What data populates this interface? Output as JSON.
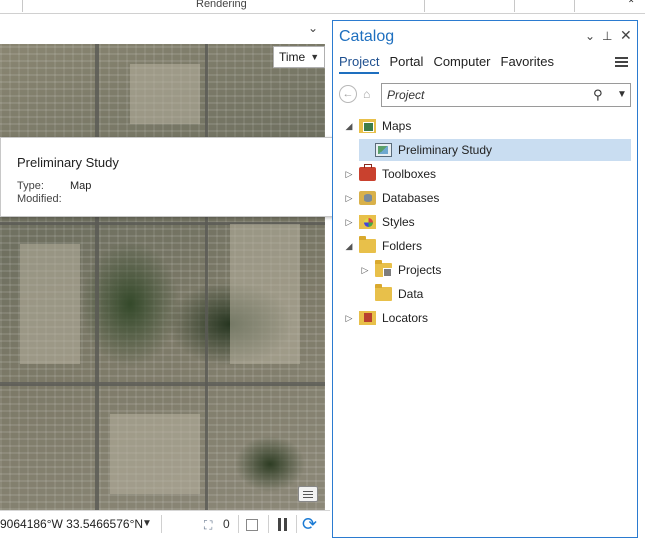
{
  "ribbon": {
    "group_label": "Rendering"
  },
  "map_view": {
    "time_button": {
      "label": "Time",
      "icon": "chevron-down-icon"
    },
    "popup": {
      "title": "Preliminary Study",
      "type_label": "Type:",
      "type_value": "Map",
      "modified_label": "Modified:",
      "modified_value": ""
    }
  },
  "statusbar": {
    "coordinates": "9064186°W 33.5466576°N",
    "selected_count": "0"
  },
  "catalog": {
    "title": "Catalog",
    "tabs": [
      {
        "label": "Project",
        "active": true
      },
      {
        "label": "Portal",
        "active": false
      },
      {
        "label": "Computer",
        "active": false
      },
      {
        "label": "Favorites",
        "active": false
      }
    ],
    "search": {
      "value": "Project",
      "placeholder": ""
    },
    "tree": [
      {
        "label": "Maps",
        "icon": "maps-folder-icon",
        "expander": "expanded",
        "level": 0
      },
      {
        "label": "Preliminary Study",
        "icon": "map-icon",
        "expander": "none",
        "level": 1,
        "selected": true
      },
      {
        "label": "Toolboxes",
        "icon": "toolbox-icon",
        "expander": "collapsed",
        "level": 0
      },
      {
        "label": "Databases",
        "icon": "database-icon",
        "expander": "collapsed",
        "level": 0
      },
      {
        "label": "Styles",
        "icon": "styles-icon",
        "expander": "collapsed",
        "level": 0
      },
      {
        "label": "Folders",
        "icon": "folder-icon",
        "expander": "expanded",
        "level": 0
      },
      {
        "label": "Projects",
        "icon": "project-folder-icon",
        "expander": "collapsed",
        "level": 1
      },
      {
        "label": "Data",
        "icon": "folder-icon",
        "expander": "none",
        "level": 1
      },
      {
        "label": "Locators",
        "icon": "locator-icon",
        "expander": "collapsed",
        "level": 0
      }
    ]
  },
  "colors": {
    "accent": "#1e6fbf",
    "selection": "#c9ddf1",
    "pane_border": "#2b7bd0"
  }
}
